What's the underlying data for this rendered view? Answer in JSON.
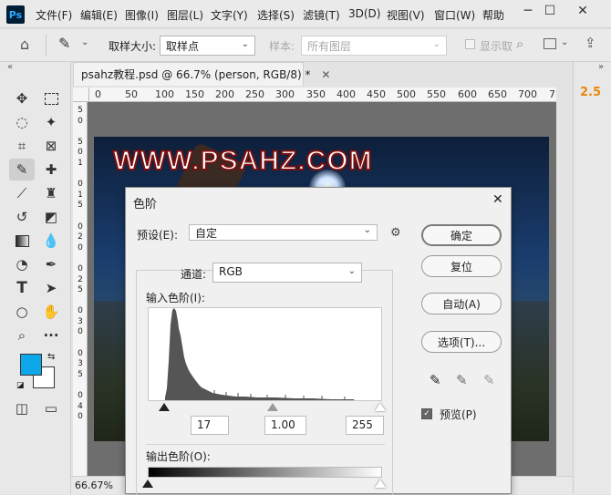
{
  "app": {
    "logo": "Ps"
  },
  "menu": [
    "文件(F)",
    "编辑(E)",
    "图像(I)",
    "图层(L)",
    "文字(Y)",
    "选择(S)",
    "滤镜(T)",
    "3D(D)",
    "视图(V)",
    "窗口(W)",
    "帮助"
  ],
  "window_controls": {
    "minimize": "─",
    "maximize": "☐",
    "close": "✕"
  },
  "options": {
    "sample_size_label": "取样大小:",
    "sample_size_value": "取样点",
    "sample_label": "样本:",
    "sample_value": "所有图层",
    "show_ring_label": "显示取"
  },
  "document": {
    "tab_title": "psahz教程.psd @ 66.7% (person, RGB/8) *",
    "close": "✕",
    "ruler_ticks": [
      "0",
      "50",
      "100",
      "150",
      "200",
      "250",
      "300",
      "350",
      "400",
      "450",
      "500",
      "550",
      "600",
      "650",
      "700",
      "7"
    ],
    "vertical_ticks": [
      "5",
      "0",
      "5",
      "0",
      "1",
      "0",
      "1",
      "5",
      "0",
      "2",
      "0",
      "0",
      "2",
      "5",
      "0",
      "3",
      "0",
      "0",
      "3",
      "5",
      "0",
      "4",
      "0",
      "0",
      "4",
      "5",
      "0",
      "5"
    ],
    "image_text": "WWW.PSAHZ.COM",
    "zoom": "66.67%"
  },
  "right_panel": {
    "value": "2.5",
    "collapse": "»"
  },
  "left_panel": {
    "collapse": "«"
  },
  "levels": {
    "title": "色阶",
    "close": "✕",
    "preset_label": "预设(E):",
    "preset_value": "自定",
    "channel_label": "通道:",
    "channel_value": "RGB",
    "input_label": "输入色阶(I):",
    "input_black": "17",
    "input_gamma": "1.00",
    "input_white": "255",
    "output_label": "输出色阶(O):",
    "buttons": {
      "ok": "确定",
      "reset": "复位",
      "auto": "自动(A)",
      "options": "选项(T)..."
    },
    "preview_label": "预览(P)",
    "preview_checked": true
  }
}
